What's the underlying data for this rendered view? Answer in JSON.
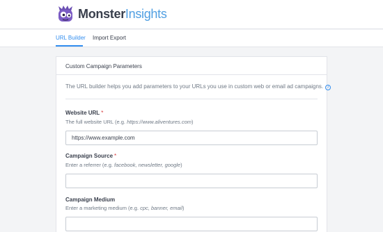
{
  "brand": {
    "name_bold": "Monster",
    "name_light": "Insights",
    "logo_icon": "monster-logo-icon"
  },
  "tabs": [
    {
      "label": "URL Builder",
      "active": true
    },
    {
      "label": "Import Export",
      "active": false
    }
  ],
  "card": {
    "title": "Custom Campaign Parameters",
    "intro": "The URL builder helps you add parameters to your URLs you use in custom web or email ad campaigns.",
    "info_icon": "info-icon"
  },
  "fields": {
    "website_url": {
      "label": "Website URL",
      "required_mark": "*",
      "hint_prefix": "The full website URL (e.g. ",
      "hint_example": "https://www.aliventures.com",
      "hint_suffix": ")",
      "value": "https://www.example.com"
    },
    "campaign_source": {
      "label": "Campaign Source",
      "required_mark": "*",
      "hint_prefix": "Enter a referrer (e.g. ",
      "hint_example": "facebook, newsletter, google",
      "hint_suffix": ")",
      "value": ""
    },
    "campaign_medium": {
      "label": "Campaign Medium",
      "hint_prefix": "Enter a marketing medium (e.g. ",
      "hint_example": "cpc, banner, email",
      "hint_suffix": ")",
      "value": ""
    }
  },
  "colors": {
    "accent": "#338eef",
    "logo_purple": "#6b4fb3",
    "required": "#d63638"
  }
}
